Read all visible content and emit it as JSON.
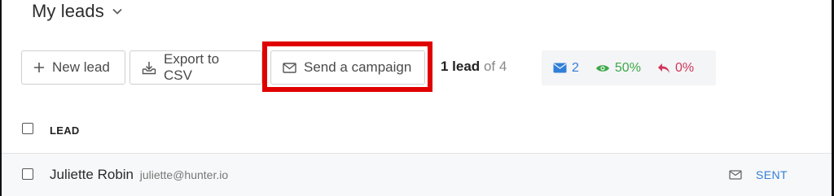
{
  "header": {
    "title": "My leads"
  },
  "toolbar": {
    "new_lead_label": "New lead",
    "export_label": "Export to CSV",
    "campaign_label": "Send a campaign"
  },
  "count": {
    "shown": "1 lead",
    "of": "of 4"
  },
  "stats": {
    "sent": "2",
    "opened": "50%",
    "replied": "0%",
    "colors": {
      "sent": "#2f7fd8",
      "opened": "#3ea84a",
      "replied": "#d1365c"
    }
  },
  "table": {
    "column_header": "LEAD",
    "rows": [
      {
        "name": "Juliette Robin",
        "email": "juliette@hunter.io",
        "status": "SENT"
      }
    ]
  },
  "highlight_color": "#e00000"
}
